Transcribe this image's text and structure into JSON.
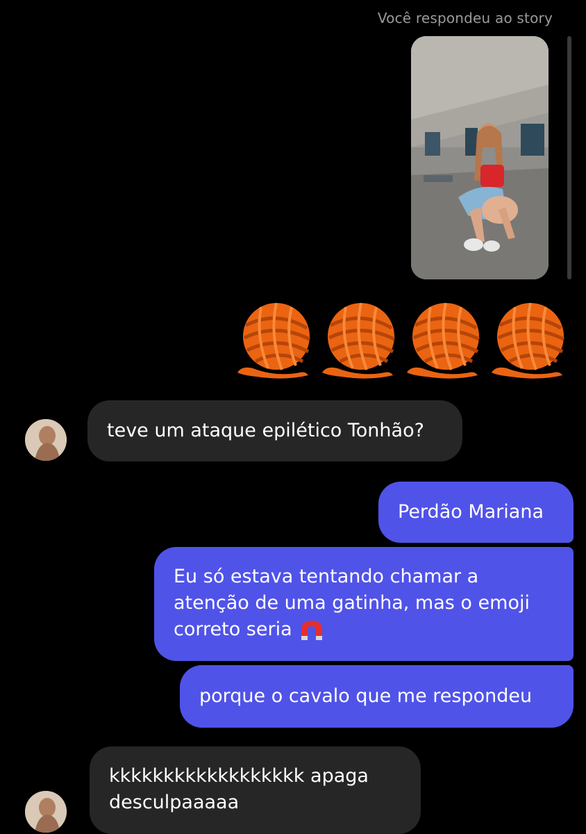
{
  "story": {
    "caption": "Você respondeu ao story"
  },
  "reaction": {
    "emoji_name": "ball-of-yarn",
    "count": 4,
    "color": "#f06a14"
  },
  "messages": [
    {
      "sender": "them",
      "text": "teve um ataque epilético Tonhão?"
    },
    {
      "sender": "me",
      "text": "Perdão Mariana"
    },
    {
      "sender": "me",
      "lines": [
        "Eu só estava tentando chamar a",
        "atenção de uma gatinha, mas o emoji",
        "correto seria"
      ],
      "trailing_emoji": "magnet"
    },
    {
      "sender": "me",
      "text": "porque o cavalo que me respondeu"
    },
    {
      "sender": "them",
      "lines": [
        "kkkkkkkkkkkkkkkkkk apaga",
        "desculpaaaaa"
      ]
    }
  ],
  "colors": {
    "background": "#000000",
    "outgoing_bubble": "#5053e8",
    "incoming_bubble": "#262626",
    "caption_text": "#9a9a9a"
  }
}
